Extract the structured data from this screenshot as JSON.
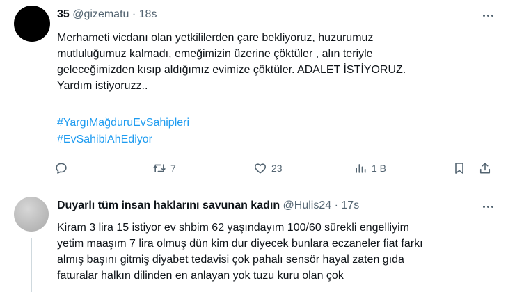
{
  "tweet1": {
    "display_name": "35",
    "handle": "@gizematu",
    "separator": "·",
    "time": "18s",
    "lines": [
      "Merhameti vicdanı olan yetkililerden çare bekliyoruz, huzurumuz",
      "mutluluğumuz kalmadı, emeğimizin üzerine çöktüler , alın teriyle",
      "geleceğimizden kısıp aldığımız evimize çöktüler. ADALET İSTİYORUZ.",
      "Yardım istiyoruzz.."
    ],
    "hashtags": [
      "#YargıMağduruEvSahipleri",
      "#EvSahibiAhEdiyor"
    ],
    "actions": {
      "reply_count": "",
      "retweet_count": "7",
      "like_count": "23",
      "view_count": "1 B"
    }
  },
  "tweet2": {
    "display_name": "Duyarlı tüm insan haklarını savunan kadın",
    "handle": "@Hulis24",
    "separator": "·",
    "time": "17s",
    "lines": [
      "Kiram 3 lira 15 istiyor ev shbim 62 yaşındayım 100/60 sürekli engelliyim",
      "yetim maaşım 7 lira olmuş dün kim dur diyecek bunlara eczaneler fiat farkı",
      "almış başını gitmiş diyabet tedavisi çok pahalı sensör hayal zaten gıda",
      "faturalar halkın dilinden en anlayan yok tuzu kuru olan çok"
    ]
  },
  "icons": [
    "more-icon",
    "reply-icon",
    "retweet-icon",
    "like-icon",
    "views-icon",
    "bookmark-icon",
    "share-icon"
  ],
  "colors": {
    "text": "#0f1419",
    "muted": "#536471",
    "link": "#1d9bf0",
    "divider": "#e4e7eb",
    "thread_line": "#cfd9de"
  }
}
